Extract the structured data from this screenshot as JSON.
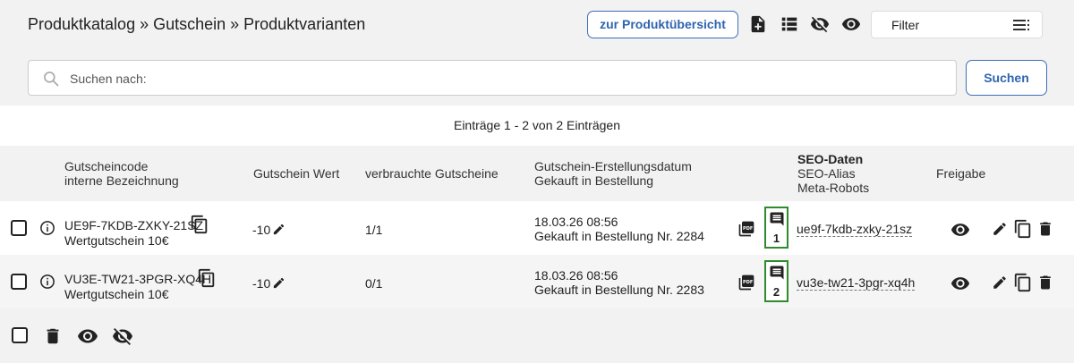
{
  "header": {
    "title": "Produktkatalog » Gutschein » Produktvarianten",
    "overview_button": "zur Produktübersicht",
    "filter_label": "Filter",
    "icons": [
      "add-document-icon",
      "list-view-icon",
      "eye-off-icon",
      "eye-icon",
      "filter-lines-icon"
    ]
  },
  "search": {
    "placeholder": "Suchen nach:",
    "button": "Suchen"
  },
  "entries_info": "Einträge 1 - 2 von 2 Einträgen",
  "table": {
    "headers": {
      "code": "Gutscheincode",
      "internal_name": "interne Bezeichnung",
      "value": "Gutschein Wert",
      "used": "verbrauchte Gutscheine",
      "created": "Gutschein-Erstellungsdatum",
      "bought_in": "Gekauft in Bestellung",
      "seo_title": "SEO-Daten",
      "seo_alias": "SEO-Alias",
      "meta_robots": "Meta-Robots",
      "release": "Freigabe"
    },
    "rows": [
      {
        "code": "UE9F-7KDB-ZXKY-21SZ",
        "name": "Wertgutschein 10€",
        "value": "-10",
        "used": "1/1",
        "date": "18.03.26 08:56",
        "order": "Gekauft in Bestellung Nr. 2284",
        "comments": "1",
        "seo_alias": "ue9f-7kdb-zxky-21sz"
      },
      {
        "code": "VU3E-TW21-3PGR-XQ4H",
        "name": "Wertgutschein 10€",
        "value": "-10",
        "used": "0/1",
        "date": "18.03.26 08:56",
        "order": "Gekauft in Bestellung Nr. 2283",
        "comments": "2",
        "seo_alias": "vu3e-tw21-3pgr-xq4h"
      }
    ]
  },
  "colors": {
    "accent": "#2f64b0",
    "comment_border": "#2e8b2e",
    "header_bg": "#f2f2f2"
  }
}
